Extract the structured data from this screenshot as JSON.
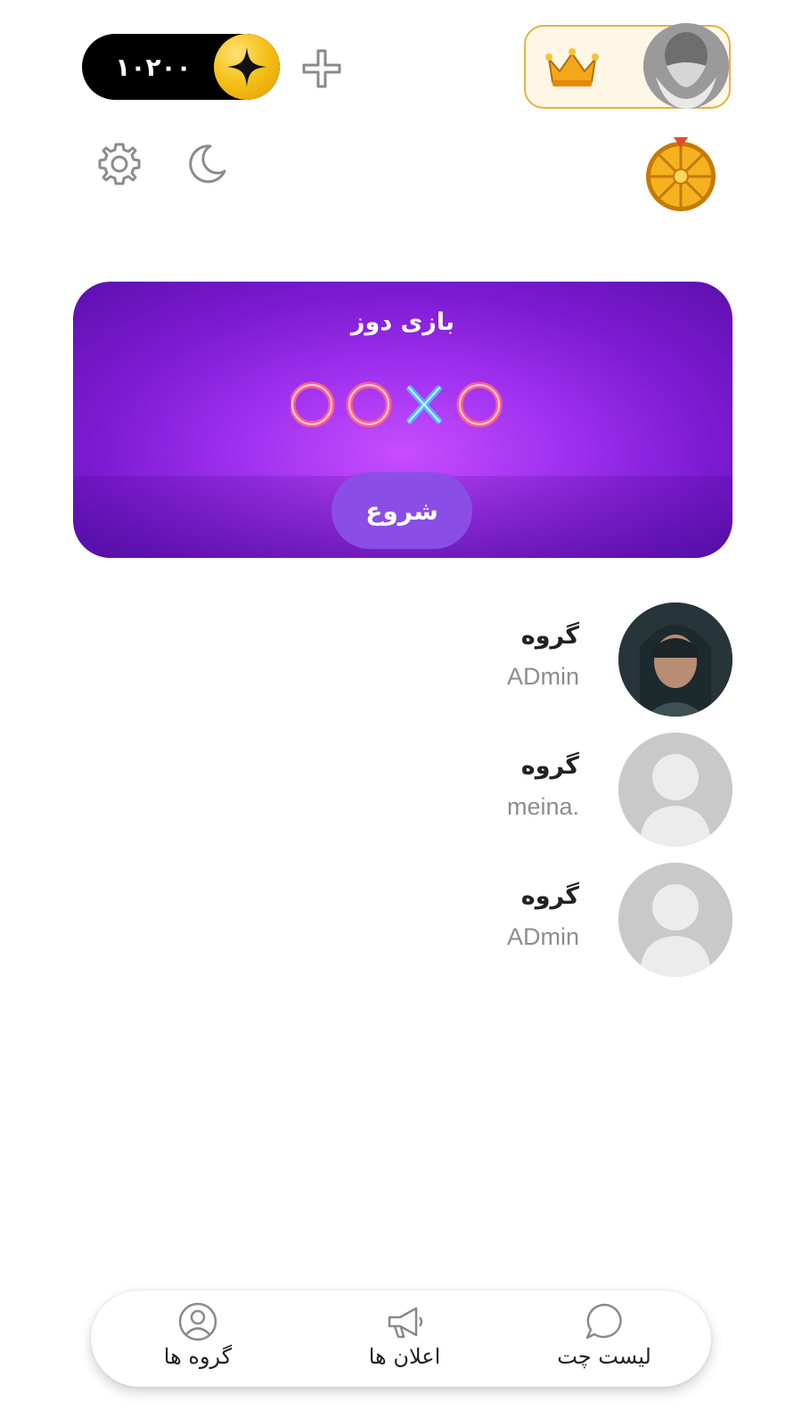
{
  "header": {
    "coin_balance": "۱۰۲۰۰",
    "accent_gold": "#f5c21a",
    "icons": [
      "plus-icon",
      "crown-icon",
      "gear-icon",
      "moon-icon",
      "prize-wheel-icon"
    ]
  },
  "game_banner": {
    "title": "بازی دوز",
    "start_label": "شروع",
    "background_color": "#a233f0",
    "symbols": [
      "O",
      "O",
      "X",
      "O"
    ]
  },
  "groups": [
    {
      "name": "گروه",
      "subtitle": "ADmin",
      "avatar": "photo"
    },
    {
      "name": "گروه",
      "subtitle": "meina.",
      "avatar": "placeholder"
    },
    {
      "name": "گروه",
      "subtitle": "ADmin",
      "avatar": "placeholder"
    }
  ],
  "bottom_nav": {
    "items": [
      {
        "label": "گروه ها",
        "icon": "user-circle-icon"
      },
      {
        "label": "اعلان ها",
        "icon": "megaphone-icon"
      },
      {
        "label": "لیست چت",
        "icon": "chat-bubble-icon"
      }
    ]
  }
}
